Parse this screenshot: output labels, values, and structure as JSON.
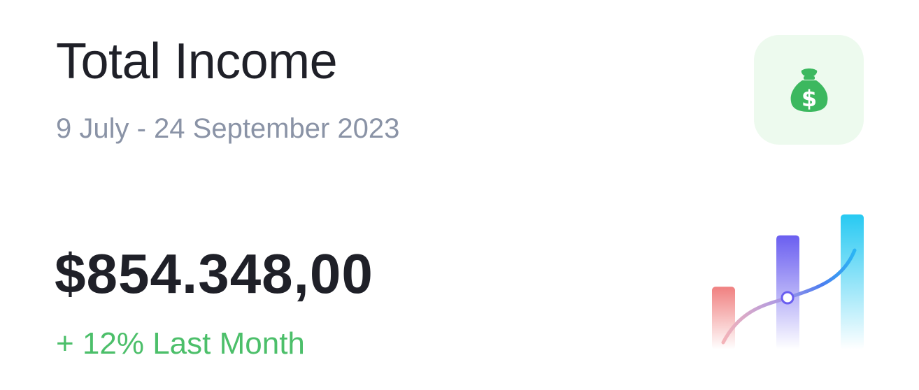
{
  "card": {
    "title": "Total Income",
    "date_range": "9 July - 24 September 2023",
    "amount": "$854.348,00",
    "change_text": "+ 12% Last Month"
  },
  "icon": {
    "name": "money-bag-icon",
    "glyph": "$",
    "color": "#3cb85f",
    "background": "#edfaee"
  },
  "colors": {
    "title": "#1f2028",
    "subtitle": "#8a93a6",
    "positive": "#4cbf6a"
  },
  "mini_chart": {
    "bars": [
      {
        "name": "bar-1",
        "value": 0.39,
        "top_color": "#f08080"
      },
      {
        "name": "bar-2",
        "value": 0.71,
        "top_color": "#6a5ef0"
      },
      {
        "name": "bar-3",
        "value": 0.84,
        "top_color": "#27c9f2"
      }
    ]
  }
}
